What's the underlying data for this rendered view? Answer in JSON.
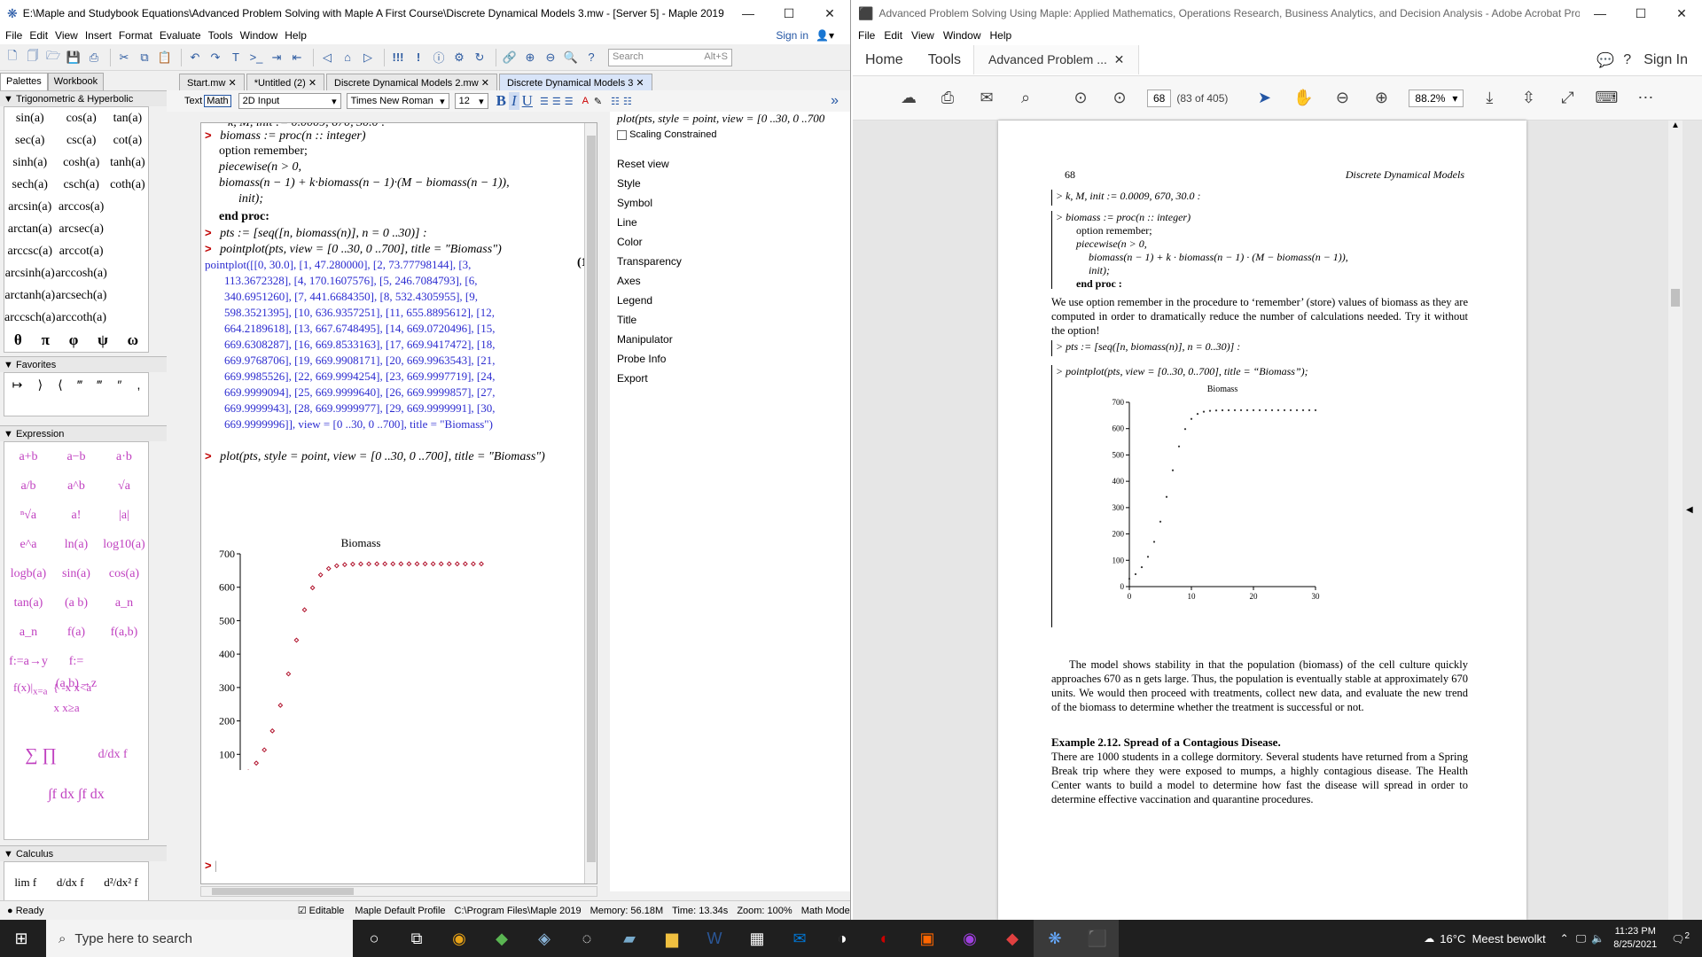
{
  "maple": {
    "title": "E:\\Maple and Studybook Equations\\Advanced Problem Solving with Maple A First Course\\Discrete Dynamical Models 3.mw - [Server 5] - Maple 2019",
    "menu": [
      "File",
      "Edit",
      "View",
      "Insert",
      "Format",
      "Evaluate",
      "Tools",
      "Window",
      "Help"
    ],
    "sign_in": "Sign in",
    "search_placeholder": "Search",
    "search_shortcut": "Alt+S",
    "palette_tabs": [
      "Palettes",
      "Workbook"
    ],
    "palette_sections": {
      "trig": "Trigonometric & Hyperbolic",
      "favorites": "Favorites",
      "expression": "Expression",
      "calculus": "Calculus"
    },
    "trig_items": [
      "sin(a)",
      "cos(a)",
      "tan(a)",
      "sec(a)",
      "csc(a)",
      "cot(a)",
      "sinh(a)",
      "cosh(a)",
      "tanh(a)",
      "sech(a)",
      "csch(a)",
      "coth(a)",
      "arcsin(a)",
      "arccos(a)",
      "",
      "arctan(a)",
      "arcsec(a)",
      "",
      "arccsc(a)",
      "arccot(a)",
      "",
      "arcsinh(a)",
      "arccosh(a)",
      "",
      "arctanh(a)",
      "arcsech(a)",
      "",
      "arccsch(a)",
      "arccoth(a)",
      ""
    ],
    "greek": [
      "θ",
      "π",
      "φ",
      "ψ",
      "ω"
    ],
    "favorites_items": [
      "↦",
      "⟩",
      "⟨",
      "‴",
      "‴",
      "″",
      ","
    ],
    "expression_items": [
      "a+b",
      "a−b",
      "a·b",
      "a/b",
      "a^b",
      "√a",
      "ⁿ√a",
      "a!",
      "|a|",
      "e^a",
      "ln(a)",
      "log10(a)",
      "logb(a)",
      "sin(a)",
      "cos(a)",
      "tan(a)",
      "(a b)",
      "a_n",
      "a_n",
      "f(a)",
      "f(a,b)",
      "f:=a→y",
      "f:=(a,b)→z",
      ""
    ],
    "calculus_items": [
      "lim f",
      "d/dx f",
      "d²/dx² f"
    ],
    "doc_tabs": [
      "Start.mw",
      "*Untitled (2)",
      "Discrete Dynamical Models 2.mw",
      "Discrete Dynamical Models 3"
    ],
    "ctx": {
      "mode_text": "Text",
      "mode_math": "Math",
      "input_mode": "2D Input",
      "font": "Times New Roman",
      "size": "12"
    },
    "worksheet": {
      "line_top_partial": "k, M, init := 0.0009, 670, 30.0 :",
      "proc_def": "biomass := proc(n :: integer)",
      "proc_option": "option remember;",
      "proc_pw": "piecewise(n > 0,",
      "proc_body": "biomass(n − 1) + k·biomass(n − 1)·(M − biomass(n − 1)),",
      "proc_init": "init);",
      "proc_end": "end proc:",
      "pts_def": "pts := [seq([n, biomass(n)], n = 0 ..30)] :",
      "pointplot_cmd": "pointplot(pts, view = [0 ..30, 0 ..700], title = \"Biomass\")",
      "eq_label": "(1)",
      "output_lines": [
        "pointplot([[0, 30.0], [1, 47.280000], [2, 73.77798144], [3,",
        "113.3672328], [4, 170.1607576], [5, 246.7084793], [6,",
        "340.6951260], [7, 441.6684350], [8, 532.4305955], [9,",
        "598.3521395], [10, 636.9357251], [11, 655.8895612], [12,",
        "664.2189618], [13, 667.6748495], [14, 669.0720496], [15,",
        "669.6308287], [16, 669.8533163], [17, 669.9417472], [18,",
        "669.9768706], [19, 669.9908171], [20, 669.9963543], [21,",
        "669.9985526], [22, 669.9994254], [23, 669.9997719], [24,",
        "669.9999094], [25, 669.9999640], [26, 669.9999857], [27,",
        "669.9999943], [28, 669.9999977], [29, 669.9999991], [30,",
        "669.9999996]], view = [0 ..30, 0 ..700], title = \"Biomass\")"
      ],
      "plot_cmd": "plot(pts, style = point, view = [0 ..30, 0 ..700], title = \"Biomass\")",
      "plot_cmd_ctx": "plot(pts, style = point, view = [0 ..30, 0 ..700"
    },
    "ctx_panel": {
      "scaling": "Scaling Constrained",
      "items": [
        "Reset view",
        "Style",
        "Symbol",
        "Line",
        "Color",
        "Transparency",
        "Axes",
        "Legend",
        "Title",
        "Manipulator",
        "Probe Info",
        "Export"
      ]
    },
    "status": {
      "ready": "Ready",
      "editable": "Editable",
      "profile": "Maple Default Profile",
      "path": "C:\\Program Files\\Maple 2019",
      "memory": "Memory: 56.18M",
      "time": "Time: 13.34s",
      "zoom": "Zoom: 100%",
      "mode": "Math Mode"
    }
  },
  "chart_data": [
    {
      "type": "scatter",
      "title": "Biomass",
      "xlim": [
        0,
        30
      ],
      "ylim": [
        0,
        700
      ],
      "xticks": [
        0,
        10,
        20,
        30
      ],
      "yticks": [
        0,
        100,
        200,
        300,
        400,
        500,
        600,
        700
      ],
      "x": [
        0,
        1,
        2,
        3,
        4,
        5,
        6,
        7,
        8,
        9,
        10,
        11,
        12,
        13,
        14,
        15,
        16,
        17,
        18,
        19,
        20,
        21,
        22,
        23,
        24,
        25,
        26,
        27,
        28,
        29,
        30
      ],
      "y": [
        30.0,
        47.28,
        73.78,
        113.37,
        170.16,
        246.71,
        340.7,
        441.67,
        532.43,
        598.35,
        636.94,
        655.89,
        664.22,
        667.67,
        669.07,
        669.63,
        669.85,
        669.94,
        669.98,
        669.99,
        670.0,
        670.0,
        670.0,
        670.0,
        670.0,
        670.0,
        670.0,
        670.0,
        670.0,
        670.0,
        670.0
      ],
      "marker_color": "#b0102a"
    },
    {
      "type": "scatter",
      "title": "Biomass",
      "xlim": [
        0,
        30
      ],
      "ylim": [
        0,
        700
      ],
      "xticks": [
        0,
        10,
        20,
        30
      ],
      "yticks": [
        0,
        100,
        200,
        300,
        400,
        500,
        600,
        700
      ],
      "x": [
        0,
        1,
        2,
        3,
        4,
        5,
        6,
        7,
        8,
        9,
        10,
        11,
        12,
        13,
        14,
        15,
        16,
        17,
        18,
        19,
        20,
        21,
        22,
        23,
        24,
        25,
        26,
        27,
        28,
        29,
        30
      ],
      "y": [
        30.0,
        47.28,
        73.78,
        113.37,
        170.16,
        246.71,
        340.7,
        441.67,
        532.43,
        598.35,
        636.94,
        655.89,
        664.22,
        667.67,
        669.07,
        669.63,
        669.85,
        669.94,
        669.98,
        669.99,
        670.0,
        670.0,
        670.0,
        670.0,
        670.0,
        670.0,
        670.0,
        670.0,
        670.0,
        670.0,
        670.0
      ],
      "marker_color": "#333333"
    }
  ],
  "acrobat": {
    "title": "Advanced Problem Solving Using Maple: Applied Mathematics, Operations Research, Business Analytics, and Decision Analysis - Adobe Acrobat Pro...",
    "menu": [
      "File",
      "Edit",
      "View",
      "Window",
      "Help"
    ],
    "nav_home": "Home",
    "nav_tools": "Tools",
    "doc_tab": "Advanced Problem ...",
    "sign_in": "Sign In",
    "page_num": "68",
    "page_of": "(83 of 405)",
    "zoom": "88.2%",
    "page": {
      "header_num": "68",
      "header_title": "Discrete Dynamical Models",
      "cmd1": "k, M, init := 0.0009, 670, 30.0 :",
      "proc_def": "biomass := proc(n :: integer)",
      "proc_option": "option remember;",
      "proc_pw": "piecewise(n > 0,",
      "proc_body": "biomass(n − 1) + k · biomass(n − 1) · (M − biomass(n − 1)),",
      "proc_init": "init);",
      "proc_end": "end proc :",
      "para1": "We use option remember in the procedure to ‘remember’ (store) values of biomass as they are computed in order to dramatically reduce the number of calculations needed. Try it without the option!",
      "pts_cmd": "pts := [seq([n, biomass(n)], n = 0..30)] :",
      "pointplot_cmd": "pointplot(pts, view = [0..30, 0..700], title = “Biomass”);",
      "para2": "The model shows stability in that the population (biomass) of the cell culture quickly approaches 670 as n gets large. Thus, the population is eventually stable at approximately 670 units. We would then proceed with treatments, collect new data, and evaluate the new trend of the biomass to determine whether the treatment is successful or not.",
      "example_title": "Example 2.12. Spread of a Contagious Disease.",
      "para3": "There are 1000 students in a college dormitory. Several students have returned from a Spring Break trip where they were exposed to mumps, a highly contagious disease. The Health Center wants to build a model to determine how fast the disease will spread in order to determine effective vaccination and quarantine procedures."
    }
  },
  "taskbar": {
    "search_placeholder": "Type here to search",
    "weather": "16°C  Meest bewolkt",
    "time": "11:23 PM",
    "date": "8/25/2021",
    "notif_count": "2"
  }
}
